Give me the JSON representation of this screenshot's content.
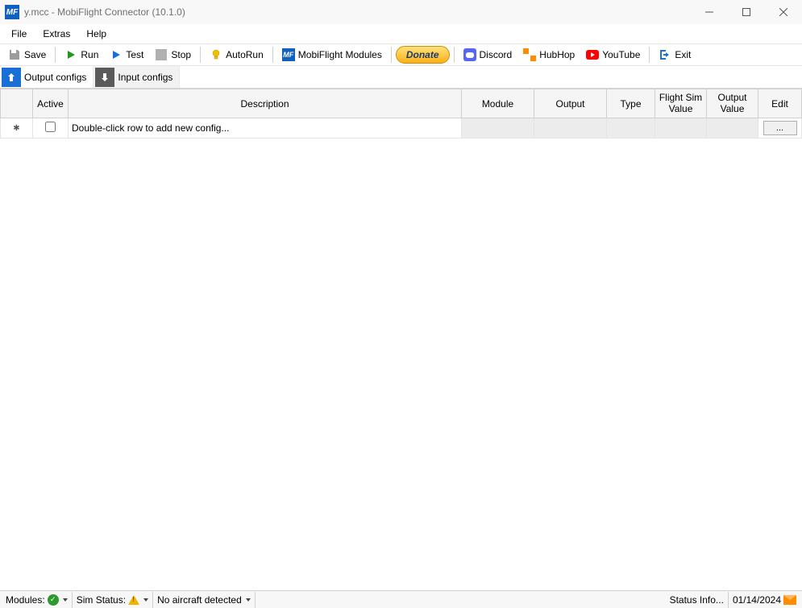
{
  "window": {
    "title": "y.mcc - MobiFlight Connector (10.1.0)"
  },
  "menu": {
    "file": "File",
    "extras": "Extras",
    "help": "Help"
  },
  "toolbar": {
    "save": "Save",
    "run": "Run",
    "test": "Test",
    "stop": "Stop",
    "autorun": "AutoRun",
    "modules": "MobiFlight Modules",
    "donate": "Donate",
    "discord": "Discord",
    "hubhop": "HubHop",
    "youtube": "YouTube",
    "exit": "Exit"
  },
  "tabs": {
    "output": "Output configs",
    "input": "Input configs"
  },
  "grid": {
    "headers": {
      "active": "Active",
      "description": "Description",
      "module": "Module",
      "output": "Output",
      "type": "Type",
      "flight_sim_value": "Flight Sim Value",
      "output_value": "Output Value",
      "edit": "Edit"
    },
    "new_row_hint": "Double-click row to add new config...",
    "edit_button": "..."
  },
  "status": {
    "modules_label": "Modules:",
    "sim_status_label": "Sim Status:",
    "aircraft": "No aircraft detected",
    "status_info": "Status Info...",
    "date": "01/14/2024"
  }
}
